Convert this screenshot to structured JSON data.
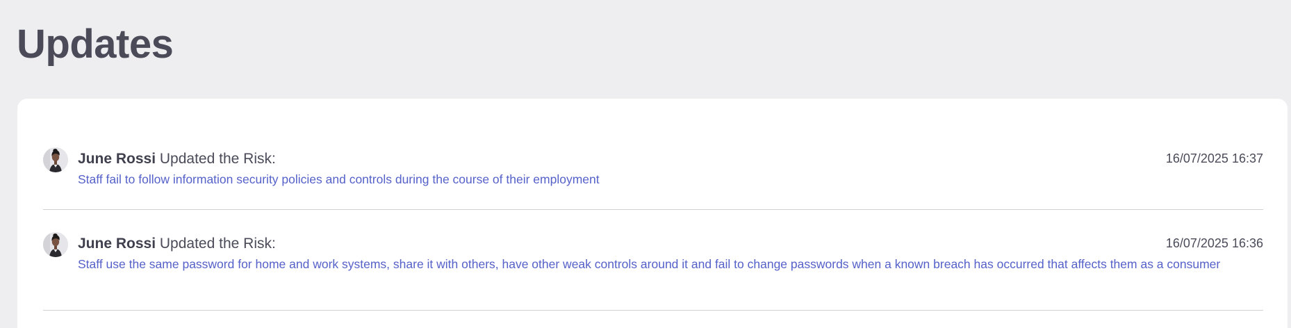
{
  "page": {
    "title": "Updates"
  },
  "updates": [
    {
      "user": "June Rossi",
      "action": "Updated the Risk:",
      "timestamp": "16/07/2025 16:37",
      "risk": "Staff fail to follow information security policies and controls during the course of their employment"
    },
    {
      "user": "June Rossi",
      "action": "Updated the Risk:",
      "timestamp": "16/07/2025 16:36",
      "risk": "Staff use the same password for home and work systems, share it with others, have other weak controls around it and fail to change passwords when a known breach has occurred that affects them as a consumer"
    }
  ],
  "colors": {
    "page_background": "#eeeef0",
    "card_background": "#ffffff",
    "link": "#5561c9",
    "heading": "#4a4a58"
  },
  "icons": {
    "avatar": "user-avatar-photo"
  }
}
